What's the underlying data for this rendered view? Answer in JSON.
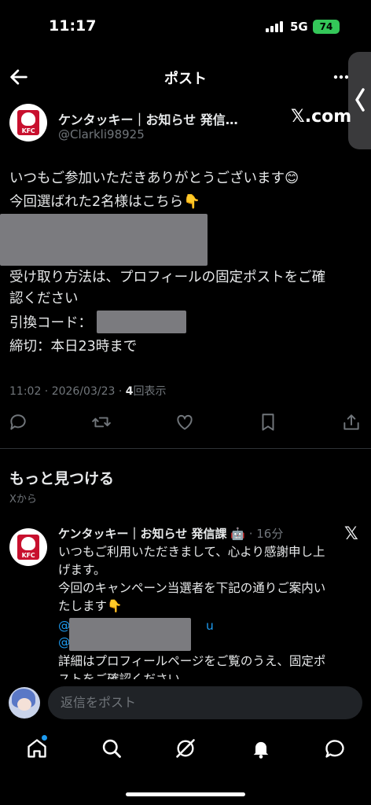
{
  "status": {
    "time": "11:17",
    "network": "5G",
    "battery": "74"
  },
  "header": {
    "title": "ポスト"
  },
  "post": {
    "author_name": "ケンタッキー｜お知らせ 発信…",
    "handle": "@Clarkli98925",
    "logo_text": "KFC",
    "badge": "𝕏.com",
    "lines": [
      "いつもご参加いただきありがとうございます😊",
      "今回選ばれた2名様はこちら👇",
      "受け取り方法は、プロフィールの固定ポストをご確",
      "認ください",
      "引換コード：",
      "締切：本日23時まで"
    ],
    "meta_time": "11:02 · 2026/03/23 · ",
    "views_count": "4",
    "views_label": "回表示"
  },
  "discover": {
    "title": "もっと見つける",
    "subtitle": "Xから"
  },
  "card": {
    "author_name": "ケンタッキー｜お知らせ 発信課",
    "bot_icon": "🤖",
    "time": " · 16分",
    "logo_text": "KFC",
    "lines": [
      "いつもご利用いただきまして、心より感謝申し上",
      "げます。",
      "今回のキャンペーン当選者を下記の通りご案内い",
      "たします👇",
      "@",
      "u",
      "@",
      "詳細はプロフィールページをご覧のうえ、固定ポ",
      "ストをご確認ください"
    ]
  },
  "reply": {
    "placeholder": "返信をポスト"
  },
  "colors": {
    "accent": "#1d9bf0",
    "background": "#000000",
    "muted": "#71767b",
    "battery": "#34c759"
  }
}
